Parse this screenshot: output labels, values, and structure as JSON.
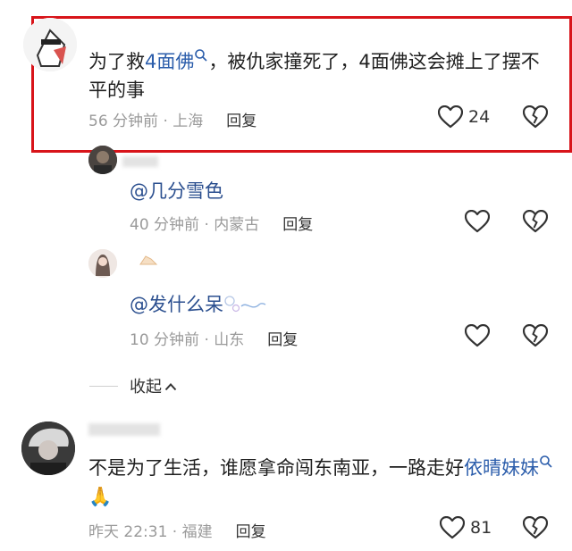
{
  "comments": [
    {
      "text_pre": "为了救",
      "link": "4面佛",
      "text_post": "，被仇家撞死了，4面佛这会摊上了摆不平的事",
      "time": "56 分钟前 · 上海",
      "reply_label": "回复",
      "like_count": "24"
    },
    {
      "text": "不是为了生活，谁愿拿命闯东南亚，一路走好",
      "link": "依晴妹妹",
      "emoji": "🙏",
      "time": "昨天 22:31 · 福建",
      "reply_label": "回复",
      "like_count": "81"
    }
  ],
  "replies": [
    {
      "text": "@几分雪色",
      "time": "40 分钟前 · 内蒙古",
      "reply_label": "回复"
    },
    {
      "text": "@发什么呆",
      "time": "10 分钟前 · 山东",
      "reply_label": "回复"
    }
  ],
  "collapse": {
    "label": "收起",
    "icon": "chevron-up-icon"
  },
  "colors": {
    "highlight_border": "#d8141a",
    "link": "#2b5dab",
    "meta": "#9a9a9a"
  }
}
